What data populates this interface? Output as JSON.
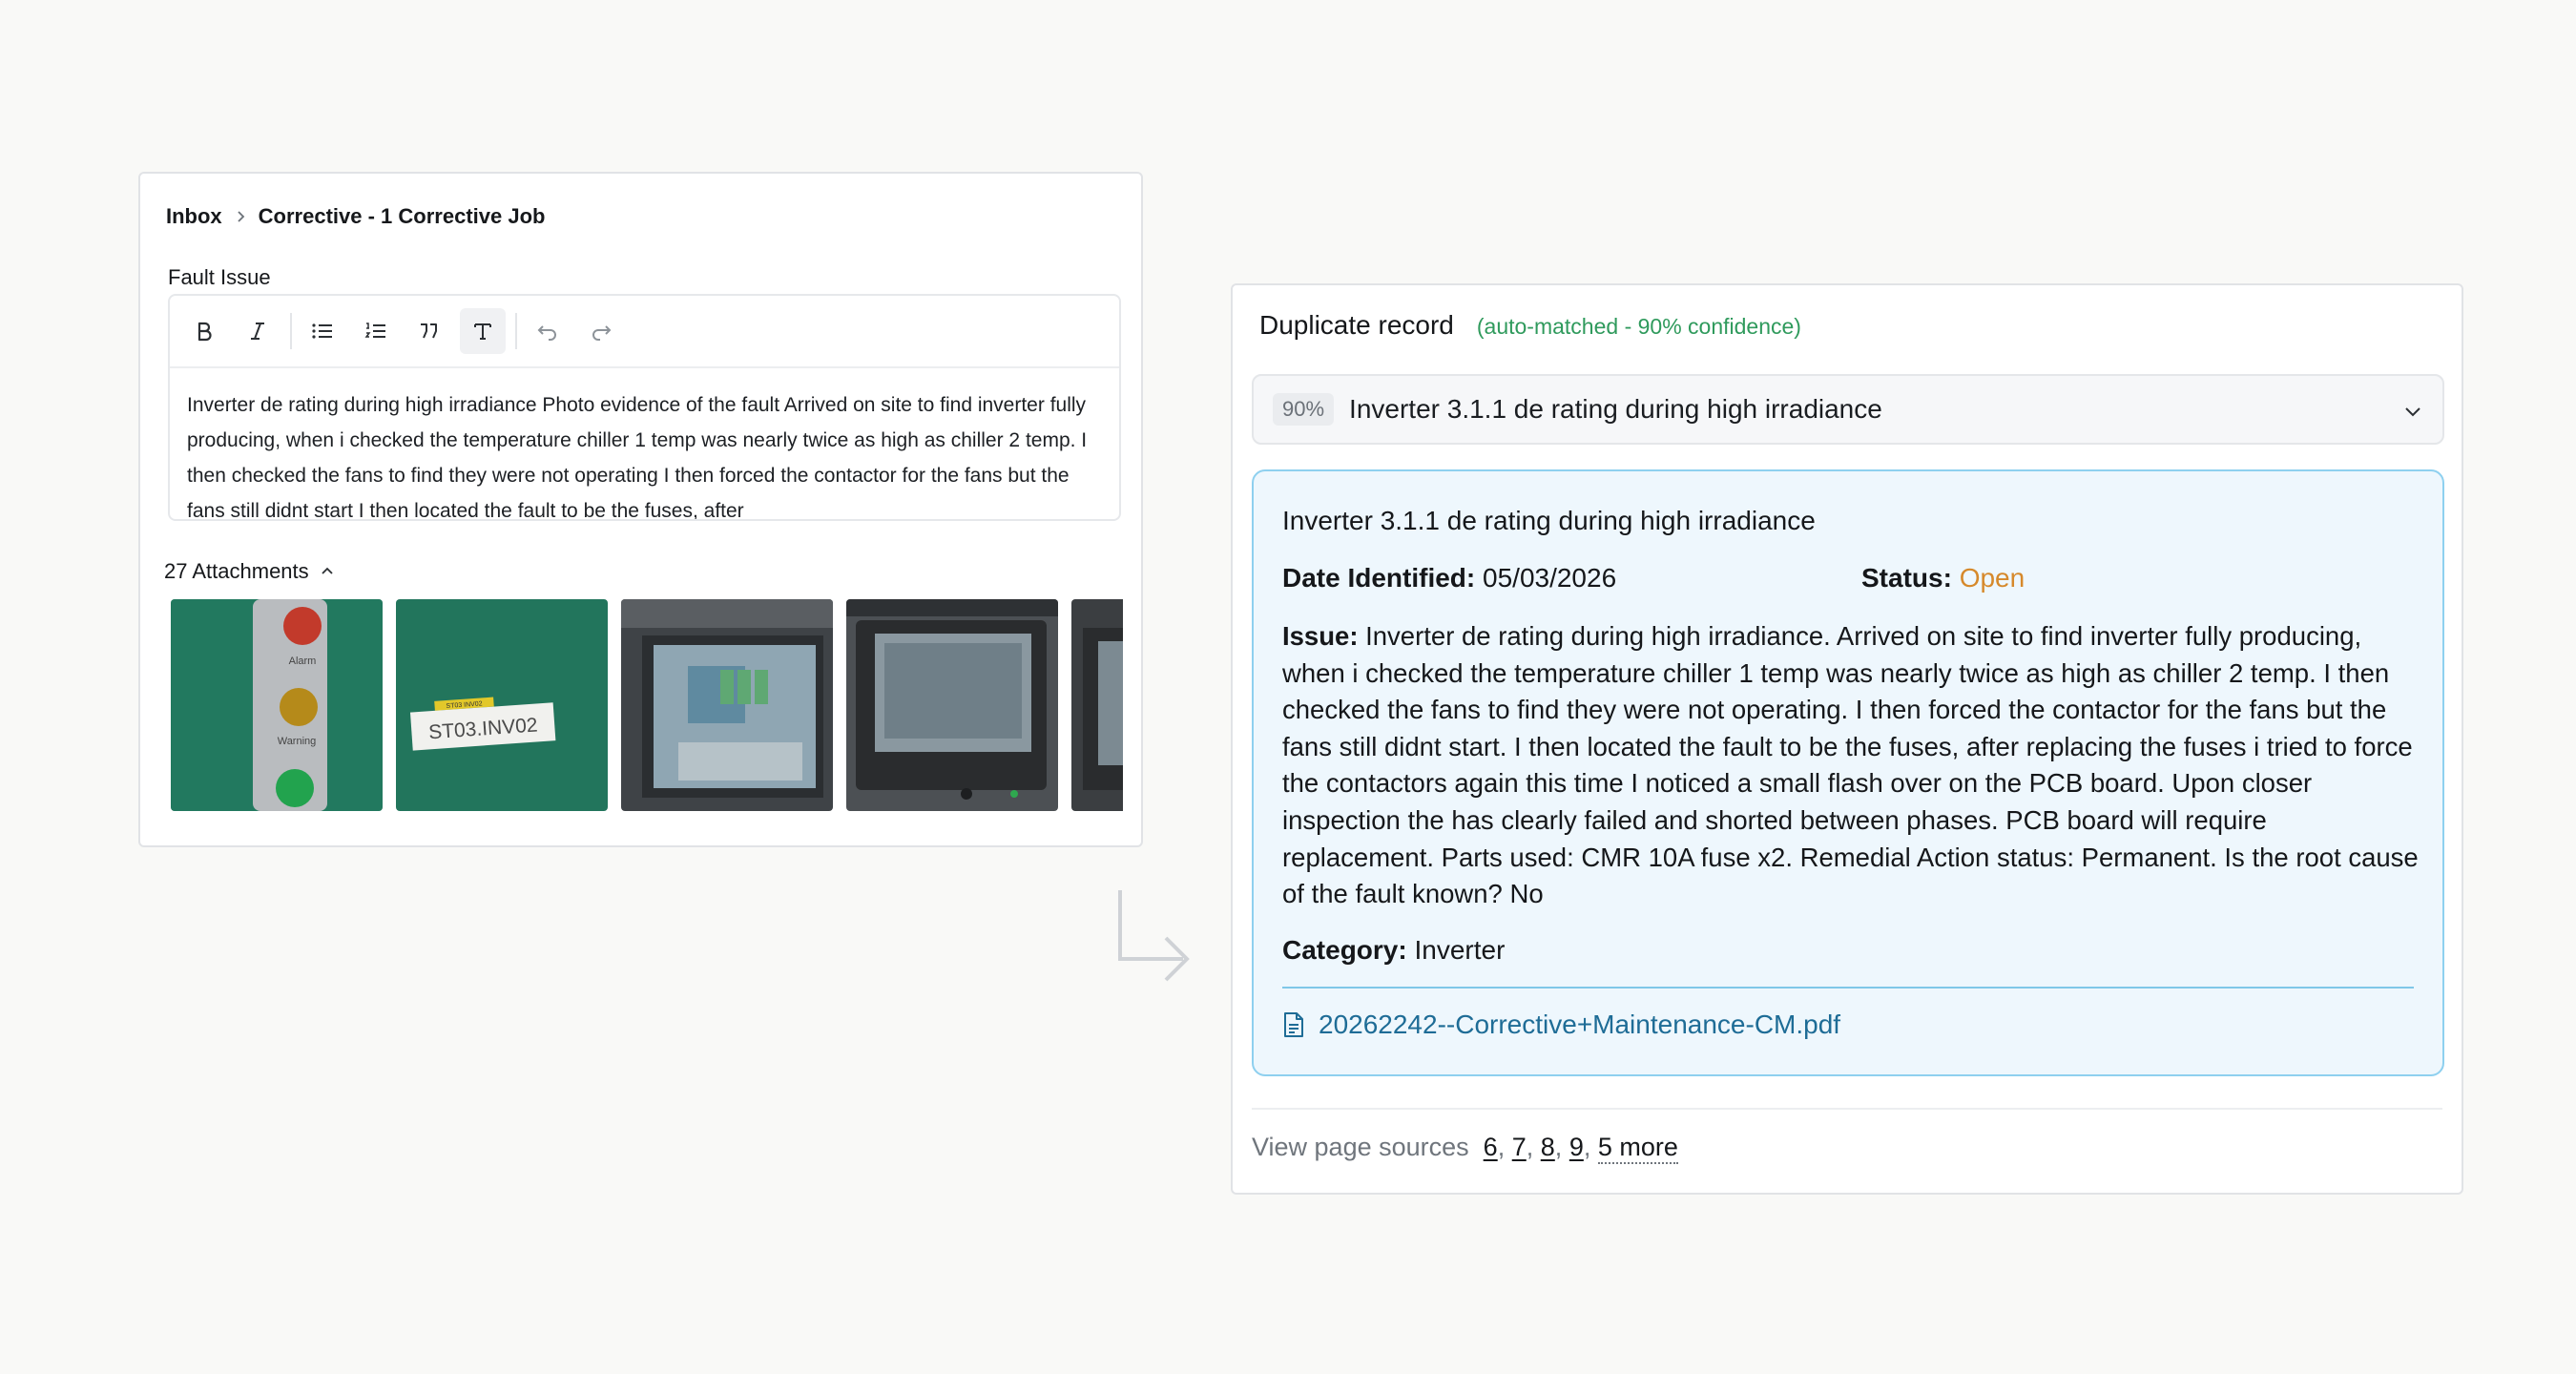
{
  "left": {
    "breadcrumb": {
      "root": "Inbox",
      "current": "Corrective - 1 Corrective Job"
    },
    "field_label": "Fault Issue",
    "toolbar": [
      "bold-icon",
      "italic-icon",
      "bullet-list-icon",
      "numbered-list-icon",
      "quote-icon",
      "text-style-icon",
      "undo-icon",
      "redo-icon"
    ],
    "editor_text": "Inverter de rating during high irradiance Photo evidence of the fault Arrived on site to find inverter fully producing, when i checked the temperature chiller 1 temp was nearly twice as high as chiller 2 temp. I then checked the fans to find they were not operating I then forced the contactor for the fans but the fans still didnt start I then located the fault to be the fuses, after",
    "attachments_label": "27 Attachments",
    "thumbnails": [
      {
        "label_lines": [
          "Alarm",
          "Warning"
        ]
      },
      {
        "label_lines": [
          "ST03 INV02",
          "ST03.INV02"
        ]
      },
      {
        "label_lines": []
      },
      {
        "label_lines": []
      },
      {
        "label_lines": []
      }
    ]
  },
  "right": {
    "title": "Duplicate record",
    "confidence": "(auto-matched - 90% confidence)",
    "match_select": {
      "percent": "90%",
      "title": "Inverter 3.1.1 de rating during high irradiance"
    },
    "detail": {
      "title": "Inverter 3.1.1 de rating during high irradiance",
      "date_label": "Date Identified:",
      "date_value": "05/03/2026",
      "status_label": "Status:",
      "status_value": "Open",
      "issue_label": "Issue:",
      "issue_text": "Inverter de rating during high irradiance. Arrived on site to find inverter fully producing, when i checked the temperature chiller 1 temp was nearly twice as high as chiller 2 temp. I then checked the fans to find they were not operating. I then forced the contactor for the fans but the fans still didnt start. I then located the fault to be the fuses, after replacing the fuses i tried to force the contactors again this time I noticed a small flash over on the PCB board. Upon closer inspection the has clearly failed and shorted between phases. PCB board will require replacement. Parts used: CMR 10A fuse x2. Remedial Action status: Permanent. Is the root cause of the fault known? No",
      "category_label": "Category:",
      "category_value": "Inverter",
      "file": "20262242--Corrective+Maintenance-CM.pdf"
    },
    "sources": {
      "label": "View page sources",
      "pages": [
        "6",
        "7",
        "8",
        "9"
      ],
      "more": "5 more"
    }
  },
  "colors": {
    "confidence_green": "#2f9a5c",
    "status_open": "#d6892b",
    "detail_bg": "#eef7fd",
    "detail_border": "#8ed0ef",
    "link_blue": "#1e6c96"
  }
}
